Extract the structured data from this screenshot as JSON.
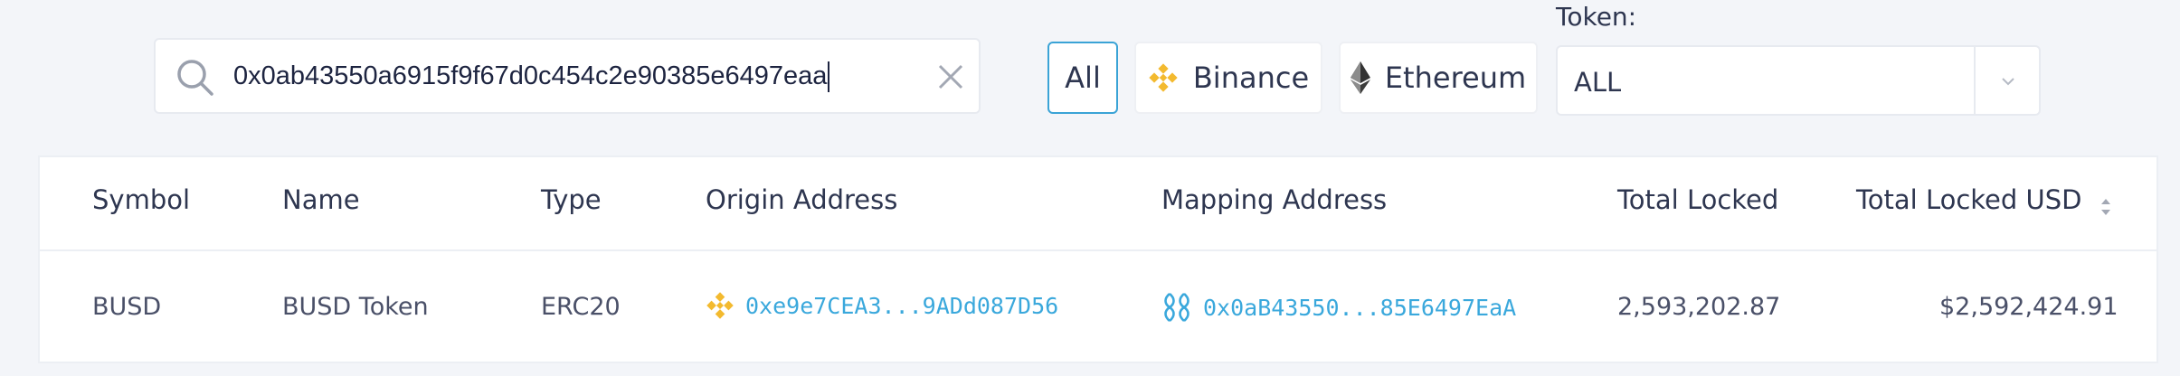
{
  "search": {
    "value": "0x0ab43550a6915f9f67d0c454c2e90385e6497eaa",
    "icon": "search-icon",
    "clear_icon": "close-icon"
  },
  "filters": {
    "all_label": "All",
    "binance_label": "Binance",
    "ethereum_label": "Ethereum",
    "active": "All"
  },
  "token": {
    "label": "Token:",
    "value": "ALL"
  },
  "table": {
    "columns": [
      "Symbol",
      "Name",
      "Type",
      "Origin Address",
      "Mapping Address",
      "Total Locked",
      "Total Locked USD"
    ],
    "rows": [
      {
        "symbol": "BUSD",
        "name": "BUSD Token",
        "type": "ERC20",
        "origin_address": "0xe9e7CEA3...9ADd087D56",
        "mapping_address": "0x0aB43550...85E6497EaA",
        "total_locked": "2,593,202.87",
        "total_locked_usd": "$2,592,424.91"
      }
    ]
  },
  "colors": {
    "accent": "#3aa8dc",
    "binance": "#f3ba2f",
    "background": "#f3f5f9"
  }
}
